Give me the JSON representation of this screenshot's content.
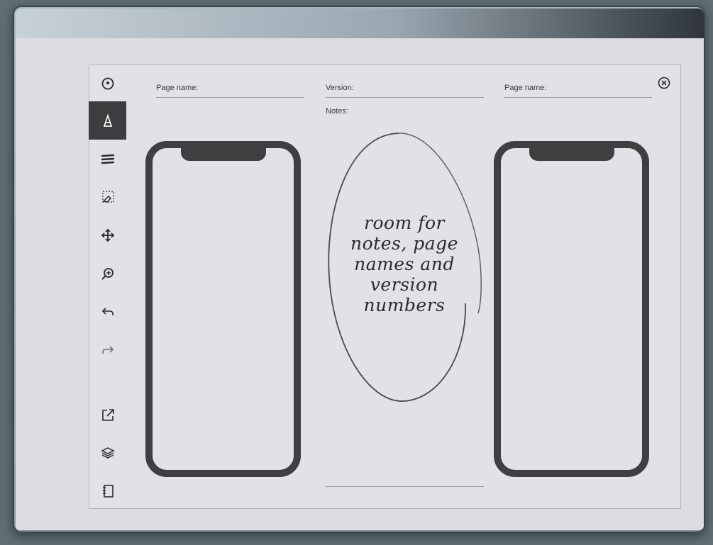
{
  "header": {
    "left_page_label": "Page name:",
    "version_label": "Version:",
    "notes_label": "Notes:",
    "right_page_label": "Page name:"
  },
  "toolbar": {
    "items": [
      {
        "icon": "clock-icon"
      },
      {
        "icon": "pen-tool-icon",
        "active": true
      },
      {
        "icon": "menu-lines-icon"
      },
      {
        "icon": "eraser-select-icon"
      },
      {
        "icon": "move-icon"
      },
      {
        "icon": "zoom-in-icon"
      },
      {
        "icon": "undo-icon"
      },
      {
        "icon": "redo-icon"
      },
      {
        "icon": "share-export-icon"
      },
      {
        "icon": "layers-icon"
      },
      {
        "icon": "notebook-icon"
      }
    ]
  },
  "notes": {
    "handwritten_lines": [
      "room for",
      "notes, page",
      "names and",
      "version",
      "numbers"
    ]
  },
  "colors": {
    "canvas": "#e2e1e6",
    "phone_frame": "#3f3f41",
    "active_tool": "#3d3d3f"
  }
}
